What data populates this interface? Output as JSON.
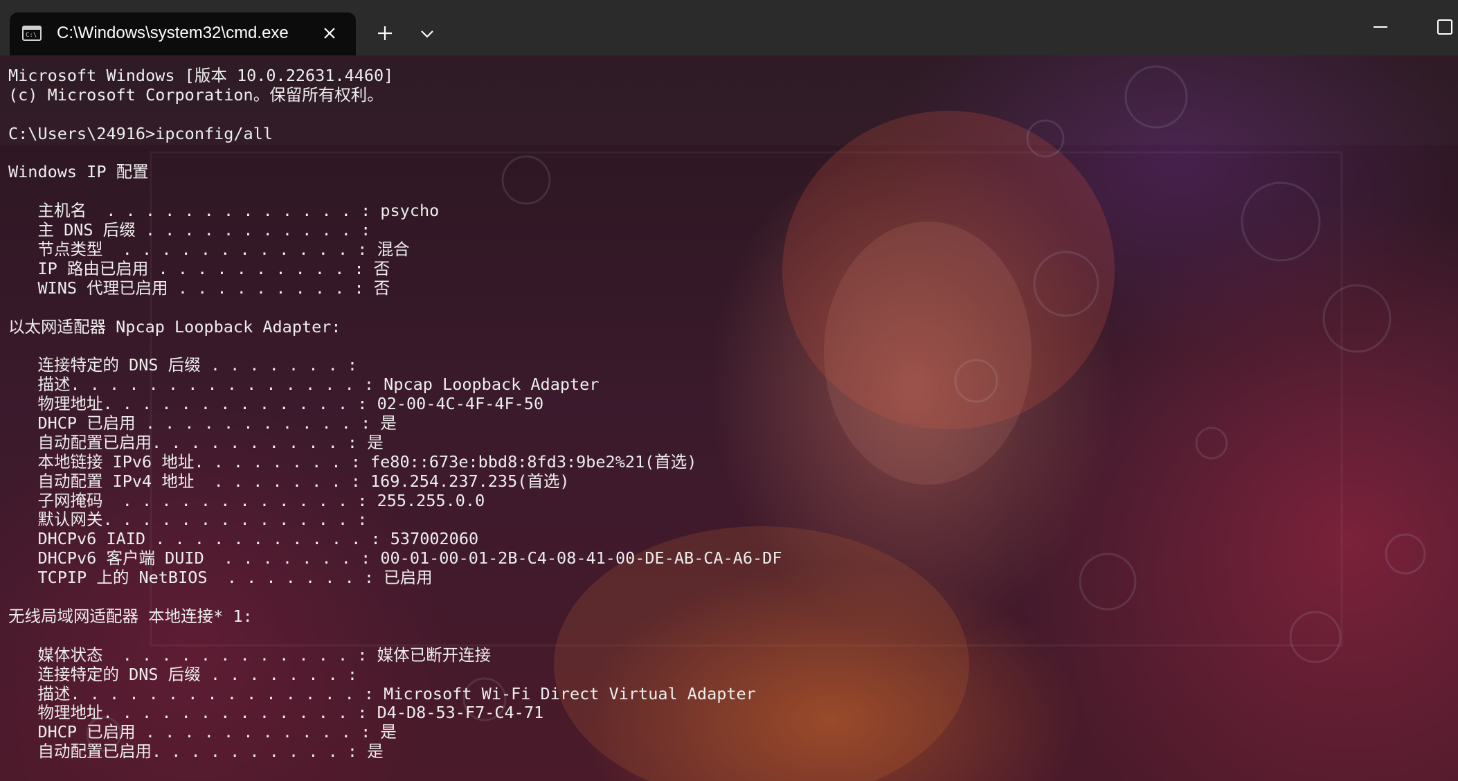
{
  "window": {
    "tab_title": "C:\\Windows\\system32\\cmd.exe",
    "tab_icon": "terminal-icon",
    "close_icon": "close-icon",
    "new_tab_icon": "plus-icon",
    "dropdown_icon": "chevron-down-icon",
    "minimize_icon": "minimize-icon",
    "maximize_icon": "maximize-icon"
  },
  "colors": {
    "titlebar": "#2b2b2b",
    "tab": "#0c0c0c",
    "text": "#eeeeee"
  },
  "console": {
    "lines": [
      "Microsoft Windows [版本 10.0.22631.4460]",
      "(c) Microsoft Corporation。保留所有权利。",
      "",
      "C:\\Users\\24916>ipconfig/all",
      "",
      "Windows IP 配置",
      "",
      "   主机名  . . . . . . . . . . . . . : psycho",
      "   主 DNS 后缀 . . . . . . . . . . . :",
      "   节点类型  . . . . . . . . . . . . : 混合",
      "   IP 路由已启用 . . . . . . . . . . : 否",
      "   WINS 代理已启用 . . . . . . . . . : 否",
      "",
      "以太网适配器 Npcap Loopback Adapter:",
      "",
      "   连接特定的 DNS 后缀 . . . . . . . :",
      "   描述. . . . . . . . . . . . . . . : Npcap Loopback Adapter",
      "   物理地址. . . . . . . . . . . . . : 02-00-4C-4F-4F-50",
      "   DHCP 已启用 . . . . . . . . . . . : 是",
      "   自动配置已启用. . . . . . . . . . : 是",
      "   本地链接 IPv6 地址. . . . . . . . : fe80::673e:bbd8:8fd3:9be2%21(首选)",
      "   自动配置 IPv4 地址  . . . . . . . : 169.254.237.235(首选)",
      "   子网掩码  . . . . . . . . . . . . : 255.255.0.0",
      "   默认网关. . . . . . . . . . . . . :",
      "   DHCPv6 IAID . . . . . . . . . . . : 537002060",
      "   DHCPv6 客户端 DUID  . . . . . . . : 00-01-00-01-2B-C4-08-41-00-DE-AB-CA-A6-DF",
      "   TCPIP 上的 NetBIOS  . . . . . . . : 已启用",
      "",
      "无线局域网适配器 本地连接* 1:",
      "",
      "   媒体状态  . . . . . . . . . . . . : 媒体已断开连接",
      "   连接特定的 DNS 后缀 . . . . . . . :",
      "   描述. . . . . . . . . . . . . . . : Microsoft Wi-Fi Direct Virtual Adapter",
      "   物理地址. . . . . . . . . . . . . : D4-D8-53-F7-C4-71",
      "   DHCP 已启用 . . . . . . . . . . . : 是",
      "   自动配置已启用. . . . . . . . . . : 是"
    ]
  }
}
